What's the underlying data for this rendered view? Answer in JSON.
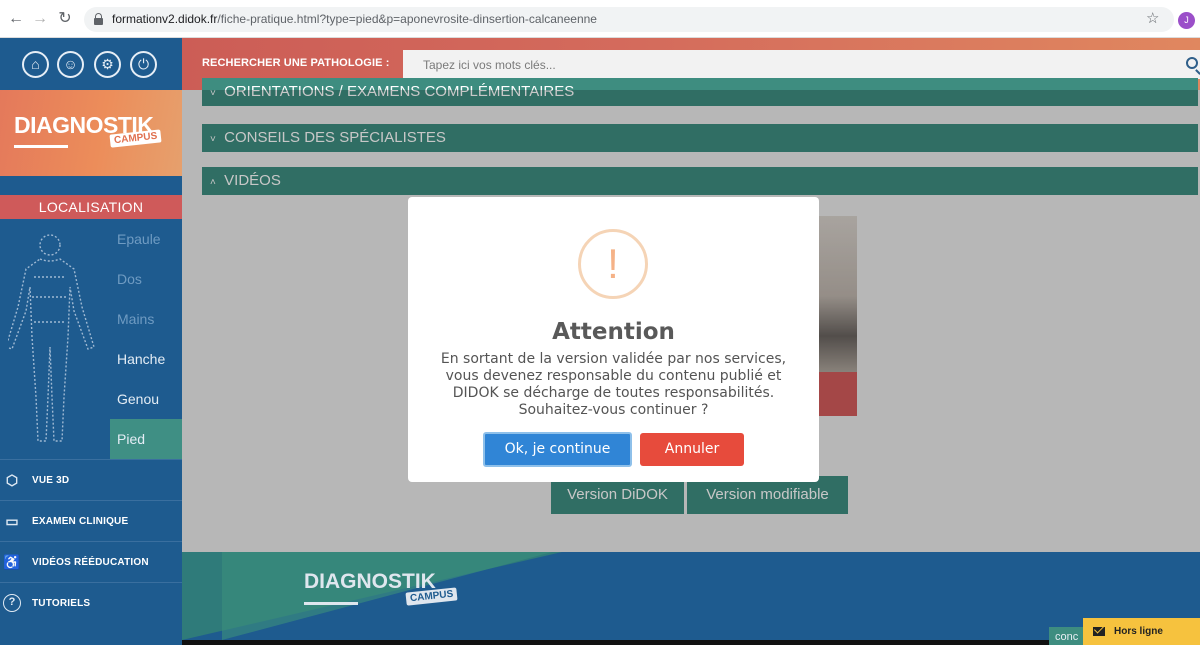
{
  "browser": {
    "url_domain": "formationv2.didok.fr",
    "url_path": "/fiche-pratique.html?type=pied&p=aponevrosite-dinsertion-calcaneenne",
    "avatar_letter": "J"
  },
  "sidebar": {
    "top_icons": [
      "home-icon",
      "head-icon",
      "gear-icon",
      "power-icon"
    ],
    "logo": {
      "text": "DIAGNOSTIK",
      "campus": "CAMPUS"
    },
    "localisation_label": "LOCALISATION",
    "body_items": [
      {
        "label": "Epaule",
        "state": "dim"
      },
      {
        "label": "Dos",
        "state": "dim"
      },
      {
        "label": "Mains",
        "state": "dim"
      },
      {
        "label": "Hanche",
        "state": "bright"
      },
      {
        "label": "Genou",
        "state": "bright"
      },
      {
        "label": "Pied",
        "state": "active"
      }
    ],
    "menu": [
      {
        "label": "VUE 3D",
        "icon": "cube-icon"
      },
      {
        "label": "EXAMEN CLINIQUE",
        "icon": "clipboard-icon"
      },
      {
        "label": "VIDÉOS RÉÉDUCATION",
        "icon": "exercise-icon"
      },
      {
        "label": "TUTORIELS",
        "icon": "help-icon"
      }
    ]
  },
  "header": {
    "search_label": "RECHERCHER UNE PATHOLOGIE :",
    "search_placeholder": "Tapez ici vos mots clés..."
  },
  "content": {
    "sections": [
      {
        "label": "ORIENTATIONS / EXAMENS COMPLÉMENTAIRES",
        "chevron": "˅"
      },
      {
        "label": "CONSEILS DES SPÉCIALISTES",
        "chevron": "˅"
      },
      {
        "label": "VIDÉOS",
        "chevron": "˄"
      }
    ],
    "version_buttons": [
      "Version DiDOK",
      "Version modifiable"
    ]
  },
  "modal": {
    "icon_glyph": "!",
    "title": "Attention",
    "message": "En sortant de la version validée par nos services, vous devenez responsable du contenu publié et DIDOK se décharge de toutes responsabilités. Souhaitez-vous continuer ?",
    "ok_label": "Ok, je continue",
    "cancel_label": "Annuler"
  },
  "footer": {
    "logo": {
      "text": "DIAGNOSTIK",
      "campus": "CAMPUS"
    },
    "conc_label": "conc",
    "offline_label": "Hors ligne"
  },
  "colors": {
    "sidebar_blue": "#1e5b8f",
    "teal": "#3e8d80",
    "coral": "#cc5d56",
    "ok_blue": "#3085d6",
    "cancel_red": "#e74b3c",
    "offline_yellow": "#f6c23e"
  }
}
